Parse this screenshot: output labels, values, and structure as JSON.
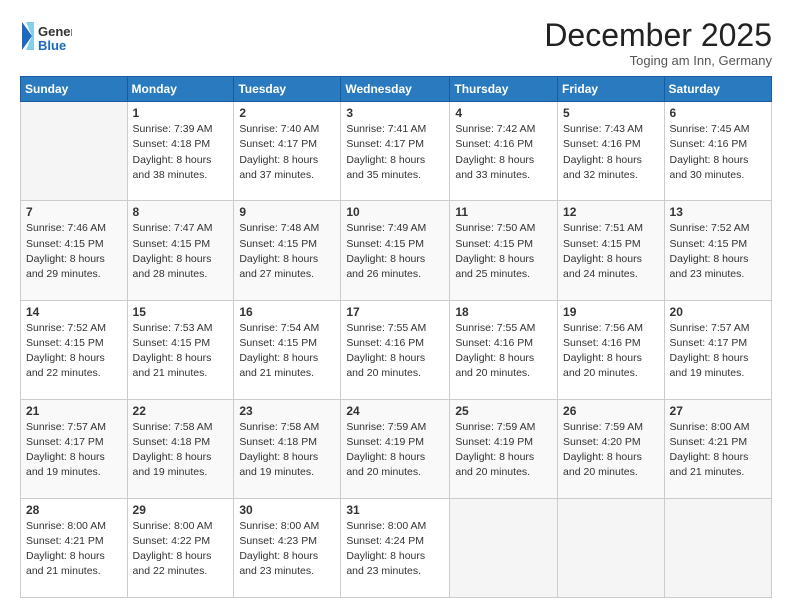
{
  "header": {
    "logo_general": "General",
    "logo_blue": "Blue",
    "month_title": "December 2025",
    "location": "Toging am Inn, Germany"
  },
  "weekdays": [
    "Sunday",
    "Monday",
    "Tuesday",
    "Wednesday",
    "Thursday",
    "Friday",
    "Saturday"
  ],
  "weeks": [
    [
      {
        "day": "",
        "info": ""
      },
      {
        "day": "1",
        "info": "Sunrise: 7:39 AM\nSunset: 4:18 PM\nDaylight: 8 hours\nand 38 minutes."
      },
      {
        "day": "2",
        "info": "Sunrise: 7:40 AM\nSunset: 4:17 PM\nDaylight: 8 hours\nand 37 minutes."
      },
      {
        "day": "3",
        "info": "Sunrise: 7:41 AM\nSunset: 4:17 PM\nDaylight: 8 hours\nand 35 minutes."
      },
      {
        "day": "4",
        "info": "Sunrise: 7:42 AM\nSunset: 4:16 PM\nDaylight: 8 hours\nand 33 minutes."
      },
      {
        "day": "5",
        "info": "Sunrise: 7:43 AM\nSunset: 4:16 PM\nDaylight: 8 hours\nand 32 minutes."
      },
      {
        "day": "6",
        "info": "Sunrise: 7:45 AM\nSunset: 4:16 PM\nDaylight: 8 hours\nand 30 minutes."
      }
    ],
    [
      {
        "day": "7",
        "info": "Sunrise: 7:46 AM\nSunset: 4:15 PM\nDaylight: 8 hours\nand 29 minutes."
      },
      {
        "day": "8",
        "info": "Sunrise: 7:47 AM\nSunset: 4:15 PM\nDaylight: 8 hours\nand 28 minutes."
      },
      {
        "day": "9",
        "info": "Sunrise: 7:48 AM\nSunset: 4:15 PM\nDaylight: 8 hours\nand 27 minutes."
      },
      {
        "day": "10",
        "info": "Sunrise: 7:49 AM\nSunset: 4:15 PM\nDaylight: 8 hours\nand 26 minutes."
      },
      {
        "day": "11",
        "info": "Sunrise: 7:50 AM\nSunset: 4:15 PM\nDaylight: 8 hours\nand 25 minutes."
      },
      {
        "day": "12",
        "info": "Sunrise: 7:51 AM\nSunset: 4:15 PM\nDaylight: 8 hours\nand 24 minutes."
      },
      {
        "day": "13",
        "info": "Sunrise: 7:52 AM\nSunset: 4:15 PM\nDaylight: 8 hours\nand 23 minutes."
      }
    ],
    [
      {
        "day": "14",
        "info": "Sunrise: 7:52 AM\nSunset: 4:15 PM\nDaylight: 8 hours\nand 22 minutes."
      },
      {
        "day": "15",
        "info": "Sunrise: 7:53 AM\nSunset: 4:15 PM\nDaylight: 8 hours\nand 21 minutes."
      },
      {
        "day": "16",
        "info": "Sunrise: 7:54 AM\nSunset: 4:15 PM\nDaylight: 8 hours\nand 21 minutes."
      },
      {
        "day": "17",
        "info": "Sunrise: 7:55 AM\nSunset: 4:16 PM\nDaylight: 8 hours\nand 20 minutes."
      },
      {
        "day": "18",
        "info": "Sunrise: 7:55 AM\nSunset: 4:16 PM\nDaylight: 8 hours\nand 20 minutes."
      },
      {
        "day": "19",
        "info": "Sunrise: 7:56 AM\nSunset: 4:16 PM\nDaylight: 8 hours\nand 20 minutes."
      },
      {
        "day": "20",
        "info": "Sunrise: 7:57 AM\nSunset: 4:17 PM\nDaylight: 8 hours\nand 19 minutes."
      }
    ],
    [
      {
        "day": "21",
        "info": "Sunrise: 7:57 AM\nSunset: 4:17 PM\nDaylight: 8 hours\nand 19 minutes."
      },
      {
        "day": "22",
        "info": "Sunrise: 7:58 AM\nSunset: 4:18 PM\nDaylight: 8 hours\nand 19 minutes."
      },
      {
        "day": "23",
        "info": "Sunrise: 7:58 AM\nSunset: 4:18 PM\nDaylight: 8 hours\nand 19 minutes."
      },
      {
        "day": "24",
        "info": "Sunrise: 7:59 AM\nSunset: 4:19 PM\nDaylight: 8 hours\nand 20 minutes."
      },
      {
        "day": "25",
        "info": "Sunrise: 7:59 AM\nSunset: 4:19 PM\nDaylight: 8 hours\nand 20 minutes."
      },
      {
        "day": "26",
        "info": "Sunrise: 7:59 AM\nSunset: 4:20 PM\nDaylight: 8 hours\nand 20 minutes."
      },
      {
        "day": "27",
        "info": "Sunrise: 8:00 AM\nSunset: 4:21 PM\nDaylight: 8 hours\nand 21 minutes."
      }
    ],
    [
      {
        "day": "28",
        "info": "Sunrise: 8:00 AM\nSunset: 4:21 PM\nDaylight: 8 hours\nand 21 minutes."
      },
      {
        "day": "29",
        "info": "Sunrise: 8:00 AM\nSunset: 4:22 PM\nDaylight: 8 hours\nand 22 minutes."
      },
      {
        "day": "30",
        "info": "Sunrise: 8:00 AM\nSunset: 4:23 PM\nDaylight: 8 hours\nand 23 minutes."
      },
      {
        "day": "31",
        "info": "Sunrise: 8:00 AM\nSunset: 4:24 PM\nDaylight: 8 hours\nand 23 minutes."
      },
      {
        "day": "",
        "info": ""
      },
      {
        "day": "",
        "info": ""
      },
      {
        "day": "",
        "info": ""
      }
    ]
  ]
}
